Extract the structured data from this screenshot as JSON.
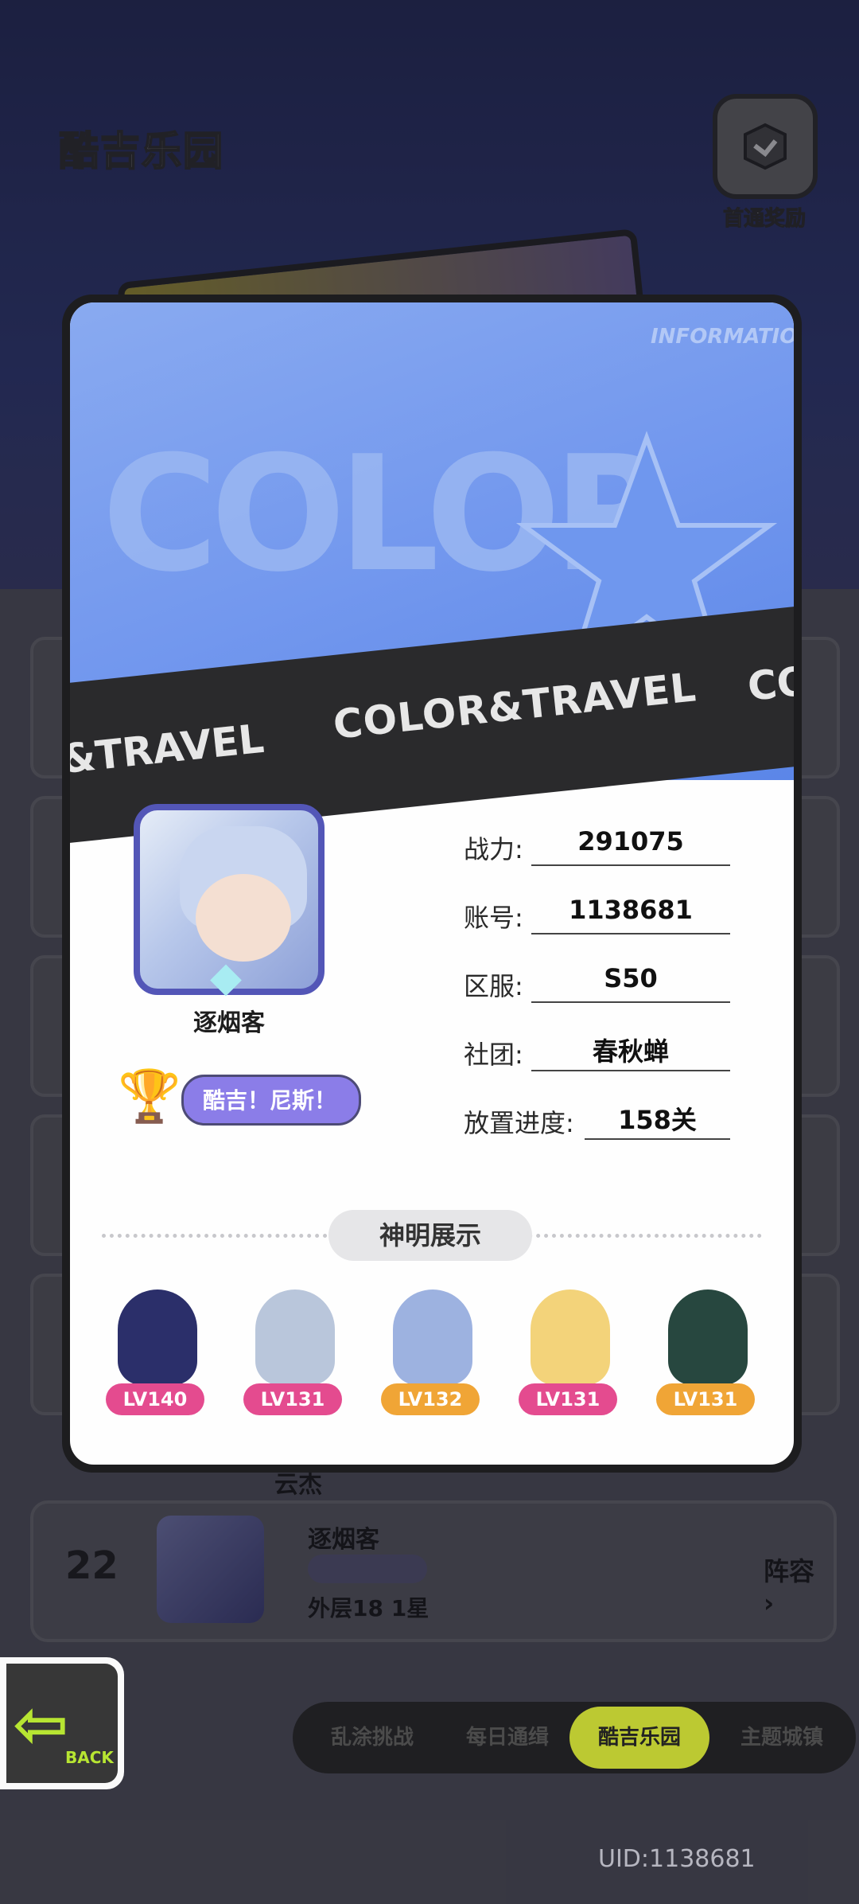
{
  "header": {
    "park_title": "酷吉乐园",
    "first_clear_reward": "首通奖励"
  },
  "card": {
    "info_tag": "INFORMATION",
    "banner_word": "COLOR",
    "strip_text": "COLOR&TRAVEL",
    "strip_text_left": "&TRAVEL",
    "strip_text_right": "CO",
    "player_name": "逐烟客",
    "title_badge": "酷吉！尼斯！",
    "stats": [
      {
        "label": "战力:",
        "value": "291075"
      },
      {
        "label": "账号:",
        "value": "1138681"
      },
      {
        "label": "区服:",
        "value": "S50"
      },
      {
        "label": "社团:",
        "value": "春秋蝉"
      },
      {
        "label": "放置进度:",
        "value": "158关"
      }
    ],
    "section_title": "神明展示",
    "gods": [
      {
        "level": "LV140",
        "badge_color": "#e44b8f",
        "char_color": "#2b2f6a"
      },
      {
        "level": "LV131",
        "badge_color": "#e44b8f",
        "char_color": "#b9c6db"
      },
      {
        "level": "LV132",
        "badge_color": "#f0a536",
        "char_color": "#9db2e0"
      },
      {
        "level": "LV131",
        "badge_color": "#e44b8f",
        "char_color": "#f3d37a"
      },
      {
        "level": "LV131",
        "badge_color": "#f0a536",
        "char_color": "#27473f"
      }
    ]
  },
  "list": {
    "prev_name": "云杰",
    "row": {
      "rank": "22",
      "name": "逐烟客",
      "floor": "外层18 1星",
      "lineup": "阵容"
    }
  },
  "back": {
    "label": "BACK"
  },
  "tabs": [
    {
      "label": "乱涂挑战"
    },
    {
      "label": "每日通缉"
    },
    {
      "label": "酷吉乐园"
    },
    {
      "label": "主题城镇"
    }
  ],
  "uid": "UID:1138681"
}
